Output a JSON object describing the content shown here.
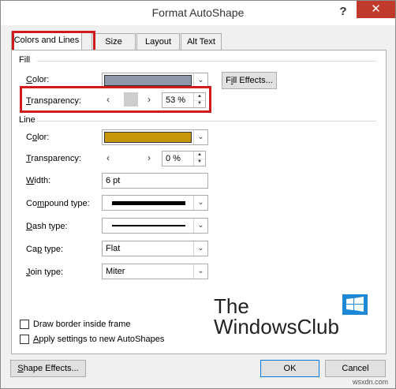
{
  "window": {
    "title": "Format AutoShape",
    "help": "?",
    "close": "✕"
  },
  "tabs": [
    {
      "label": "Colors and Lines",
      "active": true
    },
    {
      "label": "Size"
    },
    {
      "label": "Layout"
    },
    {
      "label": "Alt Text"
    }
  ],
  "fill": {
    "section": "Fill",
    "color_label": "Color:",
    "color_value": "#8e9aab",
    "fill_effects_button": "Fill Effects...",
    "transparency_label": "Transparency:",
    "transparency_value": "53 %",
    "transparency_level": 0.53
  },
  "line": {
    "section": "Line",
    "color_label": "Color:",
    "color_value": "#c8960a",
    "transparency_label": "Transparency:",
    "transparency_value": "0 %",
    "width_label": "Width:",
    "width_value": "6 pt",
    "compound_label": "Compound type:",
    "dash_label": "Dash type:",
    "cap_label": "Cap type:",
    "cap_value": "Flat",
    "join_label": "Join type:",
    "join_value": "Miter"
  },
  "options": {
    "draw_border_inside": "Draw border inside frame",
    "apply_new": "Apply settings to new AutoShapes"
  },
  "buttons": {
    "shape_effects": "Shape Effects...",
    "ok": "OK",
    "cancel": "Cancel"
  },
  "watermark": {
    "line1": "The",
    "line2": "WindowsClub",
    "url": "wsxdn.com"
  },
  "colors": {
    "highlight": "#d11a1a",
    "close_bg": "#c0392b",
    "accent": "#0078d7"
  }
}
